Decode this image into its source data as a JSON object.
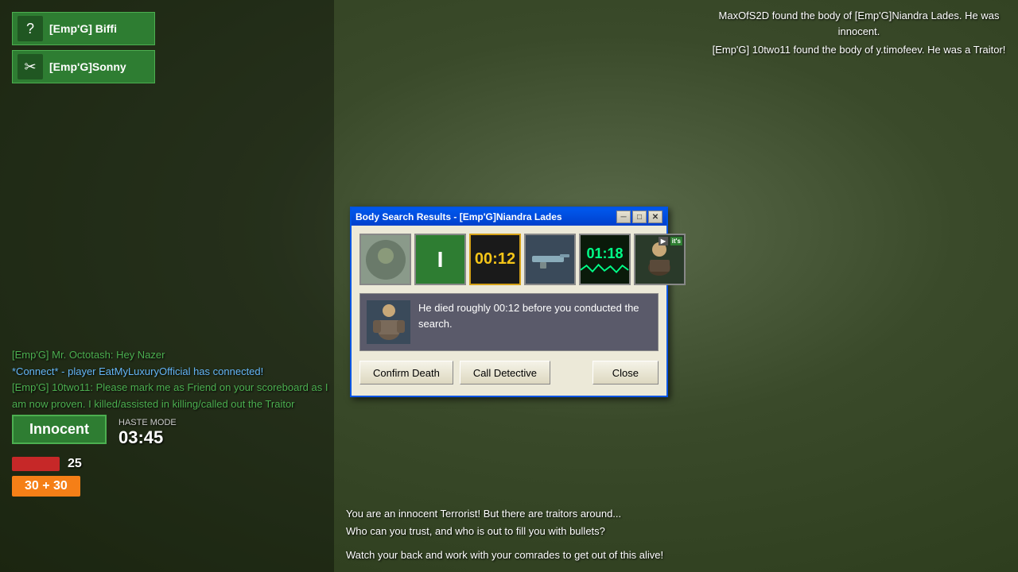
{
  "game": {
    "bg_color": "#3a4a2a"
  },
  "notifications": [
    {
      "text": "MaxOfS2D found the body of [Emp'G]Niandra Lades. He was innocent."
    },
    {
      "text": "[Emp'G] 10two11 found the body of y.timofeev. He was a Traitor!"
    }
  ],
  "players": [
    {
      "name": "[Emp'G] Biffi",
      "icon": "?"
    },
    {
      "name": "[Emp'G]Sonny",
      "icon": "✂"
    }
  ],
  "chat": [
    {
      "type": "green",
      "text": "[Emp'G] Mr. Octotash: Hey Nazer"
    },
    {
      "type": "connect",
      "text": "*Connect* - player EatMyLuxuryOfficial has connected!"
    },
    {
      "type": "green",
      "text": "[Emp'G] 10two11: Please mark me as Friend on your scoreboard as I am now proven. I killed/assisted in killing/called out the Traitor"
    }
  ],
  "hud": {
    "role": "Innocent",
    "haste_label": "HASTE MODE",
    "haste_time": "03:45",
    "health": "25",
    "ammo": "30 + 30"
  },
  "bottom_info": {
    "line1": "You are an innocent Terrorist! But there are traitors around...",
    "line2": "Who can you trust, and who is out to fill you with bullets?",
    "line3": "",
    "line4": "Watch your back and work with your comrades to get out of this alive!"
  },
  "dialog": {
    "title": "Body Search Results - [Emp'G]Niandra Lades",
    "evidence": [
      {
        "type": "face",
        "label": ""
      },
      {
        "type": "green_i",
        "label": "I"
      },
      {
        "type": "timer",
        "label": "00:12"
      },
      {
        "type": "weapon",
        "label": ""
      },
      {
        "type": "timer2",
        "label": "01:18"
      },
      {
        "type": "player",
        "label": "it's",
        "has_play": true
      }
    ],
    "info_text": "He died roughly 00:12 before you conducted the search.",
    "buttons": {
      "confirm": "Confirm Death",
      "call": "Call Detective",
      "close": "Close"
    },
    "window_controls": {
      "minimize": "─",
      "restore": "□",
      "close": "✕"
    }
  }
}
